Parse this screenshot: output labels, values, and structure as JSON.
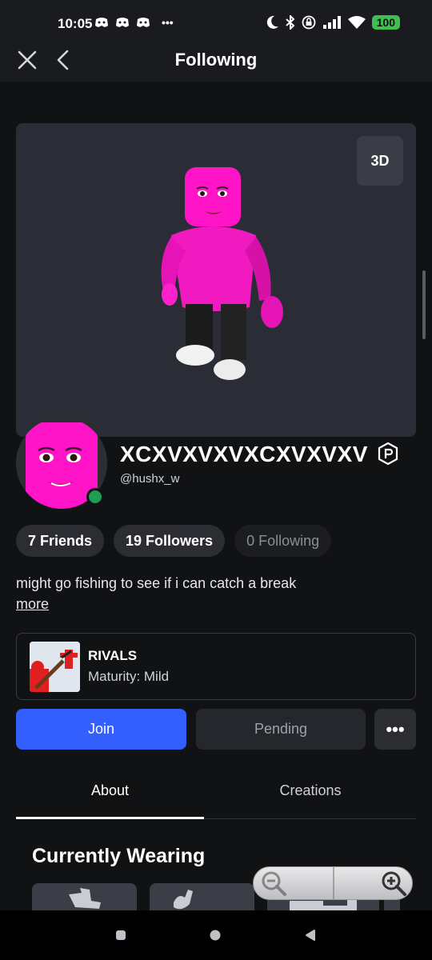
{
  "status_bar": {
    "time": "10:05",
    "overflow": "•••",
    "battery": "100",
    "icons": [
      "discord-icon",
      "discord-icon",
      "discord-icon",
      "moon-icon",
      "bluetooth-icon",
      "lock-rotation-icon",
      "signal-icon",
      "wifi-icon"
    ]
  },
  "nav": {
    "title": "Following",
    "close_icon": "close-icon",
    "back_icon": "back-arrow-icon"
  },
  "avatar": {
    "view_3d_label": "3D",
    "colors": {
      "body": "#ff14c8",
      "pants": "#222",
      "shoes": "#f2f2f2"
    }
  },
  "profile": {
    "display_name": "XCXVXVXVXCXVXVXV",
    "username": "@hushx_w",
    "online_color": "#1f9d55",
    "verified_icon": "verified-badge-icon"
  },
  "stats": {
    "friends": "7 Friends",
    "followers": "19 Followers",
    "following": "0 Following"
  },
  "bio": {
    "text": "might go fishing to see if i can catch a break",
    "more_label": "more"
  },
  "game": {
    "title": "RIVALS",
    "maturity": "Maturity: Mild"
  },
  "actions": {
    "join_label": "Join",
    "pending_label": "Pending",
    "more_label": "•••",
    "join_color": "#335fff"
  },
  "tabs": {
    "about": "About",
    "creations": "Creations"
  },
  "wearing": {
    "title": "Currently Wearing"
  }
}
